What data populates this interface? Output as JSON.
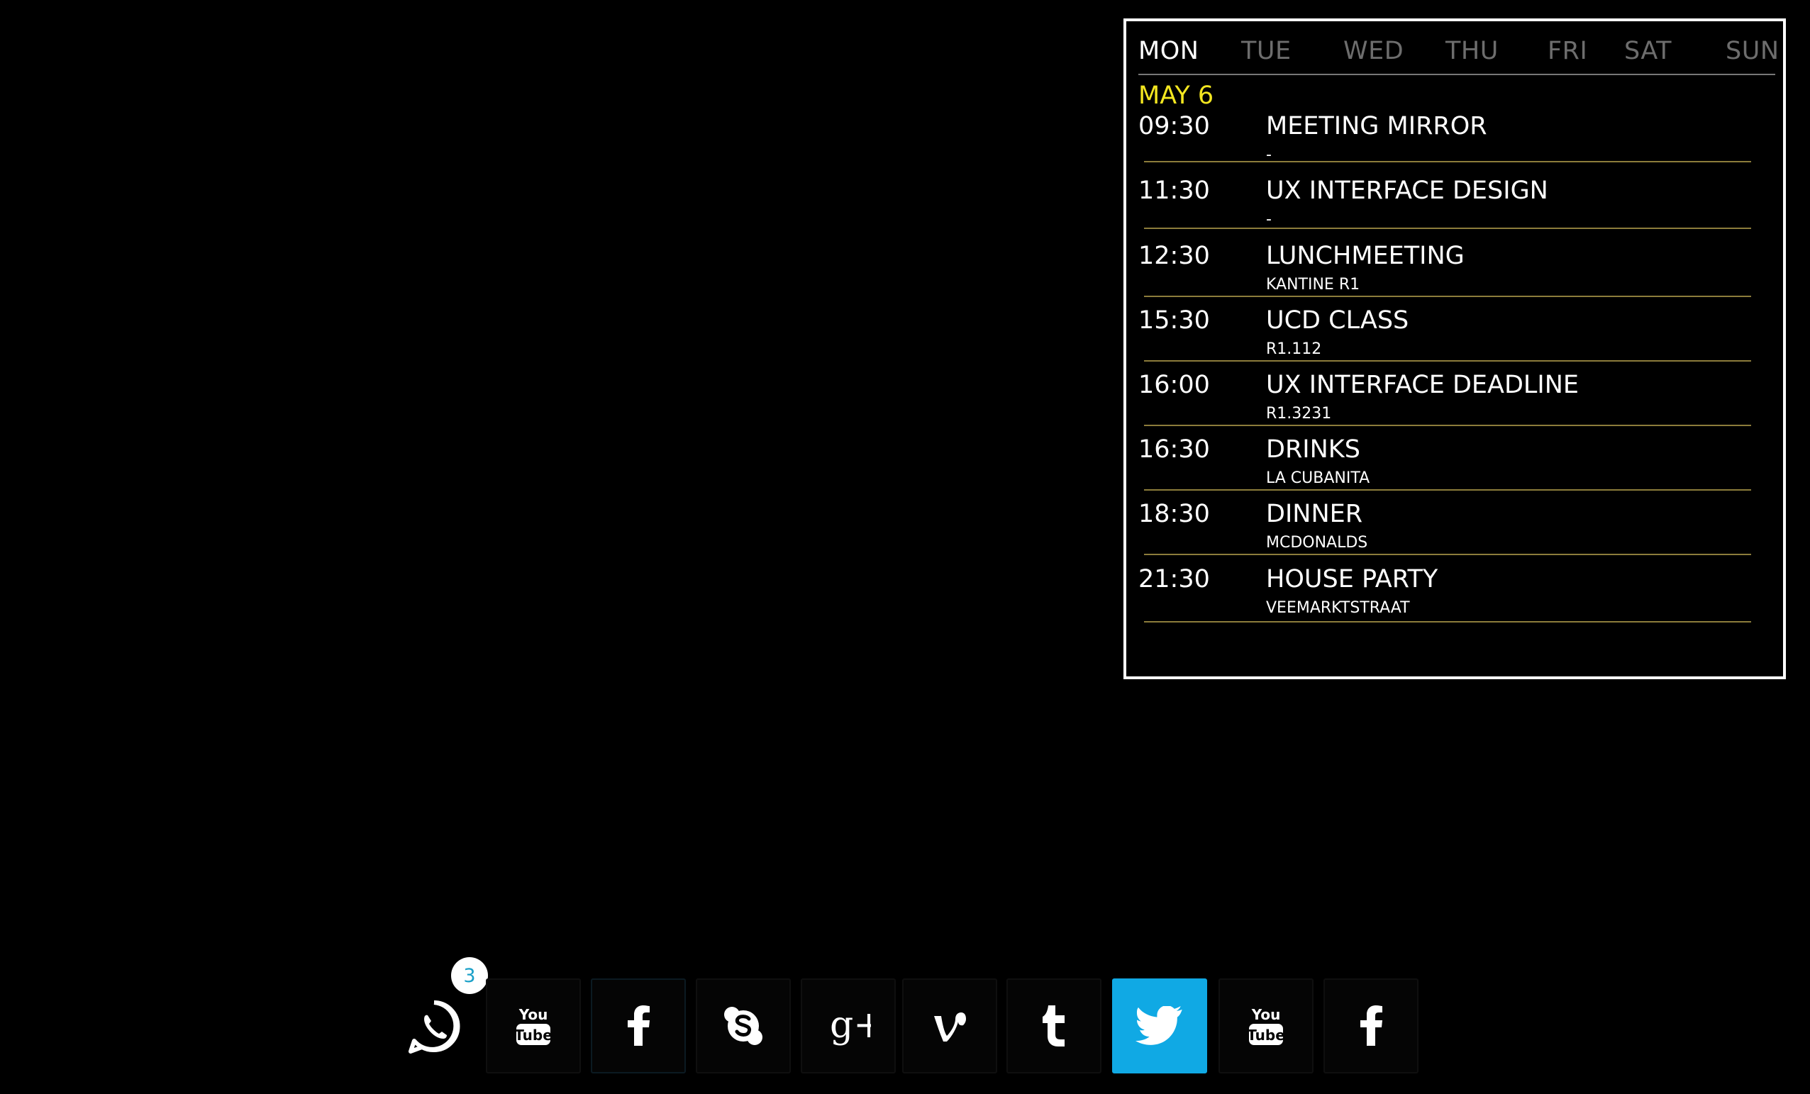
{
  "calendar": {
    "days": [
      "MON",
      "TUE",
      "WED",
      "THU",
      "FRI",
      "SAT",
      "SUN"
    ],
    "active_day": "MON",
    "date": "MAY 6",
    "events": [
      {
        "time": "09:30",
        "title": "MEETING MIRROR",
        "location": "-"
      },
      {
        "time": "11:30",
        "title": "UX INTERFACE DESIGN",
        "location": "-"
      },
      {
        "time": "12:30",
        "title": "LUNCHMEETING",
        "location": "KANTINE R1"
      },
      {
        "time": "15:30",
        "title": "UCD CLASS",
        "location": "R1.112"
      },
      {
        "time": "16:00",
        "title": "UX INTERFACE DEADLINE",
        "location": "R1.3231"
      },
      {
        "time": "16:30",
        "title": "DRINKS",
        "location": "LA CUBANITA"
      },
      {
        "time": "18:30",
        "title": "DINNER",
        "location": "MCDONALDS"
      },
      {
        "time": "21:30",
        "title": "HOUSE PARTY",
        "location": "VEEMARKTSTRAAT"
      }
    ],
    "colors": {
      "date": "#f3e620",
      "inactive_day": "#6d6d6d",
      "separator": "#8c7c3b"
    }
  },
  "dock": {
    "notification_count": "3",
    "apps": [
      {
        "icon": "whatsapp-icon"
      },
      {
        "icon": "youtube-icon",
        "text_top": "You",
        "text_bottom": "Tube"
      },
      {
        "icon": "facebook-icon",
        "glyph": "f"
      },
      {
        "icon": "skype-icon"
      },
      {
        "icon": "google-plus-icon",
        "glyph": "g+"
      },
      {
        "icon": "vine-icon"
      },
      {
        "icon": "tumblr-icon",
        "glyph": "t"
      },
      {
        "icon": "twitter-icon",
        "active": true
      },
      {
        "icon": "youtube-icon",
        "text_top": "You",
        "text_bottom": "Tube"
      },
      {
        "icon": "facebook-icon",
        "glyph": "f"
      }
    ],
    "colors": {
      "active_tile": "#10a9e4",
      "badge_text": "#1aa0c8"
    }
  }
}
